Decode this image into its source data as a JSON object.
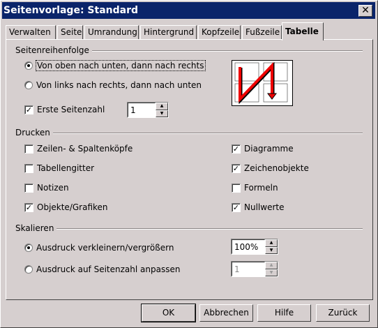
{
  "window": {
    "title": "Seitenvorlage: Standard",
    "close": "✕"
  },
  "tabs": [
    "Verwalten",
    "Seite",
    "Umrandung",
    "Hintergrund",
    "Kopfzeile",
    "Fußzeile",
    "Tabelle"
  ],
  "active_tab": "Tabelle",
  "page_order": {
    "label": "Seitenreihenfolge",
    "opt1": "Von oben nach unten, dann nach rechts",
    "opt2": "Von links nach rechts, dann nach unten",
    "first_page_label": "Erste Seitenzahl",
    "first_page_checked": true,
    "first_page_value": "1"
  },
  "print": {
    "label": "Drucken",
    "items": [
      {
        "label": "Zeilen- & Spaltenköpfe",
        "checked": false
      },
      {
        "label": "Tabellengitter",
        "checked": false
      },
      {
        "label": "Notizen",
        "checked": false
      },
      {
        "label": "Objekte/Grafiken",
        "checked": true
      },
      {
        "label": "Diagramme",
        "checked": true
      },
      {
        "label": "Zeichenobjekte",
        "checked": true
      },
      {
        "label": "Formeln",
        "checked": false
      },
      {
        "label": "Nullwerte",
        "checked": true
      }
    ]
  },
  "scale": {
    "label": "Skalieren",
    "opt1": "Ausdruck verkleinern/vergrößern",
    "opt1_value": "100%",
    "opt2": "Ausdruck auf Seitenzahl anpassen",
    "opt2_value": "1"
  },
  "buttons": {
    "ok": "OK",
    "cancel": "Abbrechen",
    "help": "Hilfe",
    "back": "Zurück"
  }
}
